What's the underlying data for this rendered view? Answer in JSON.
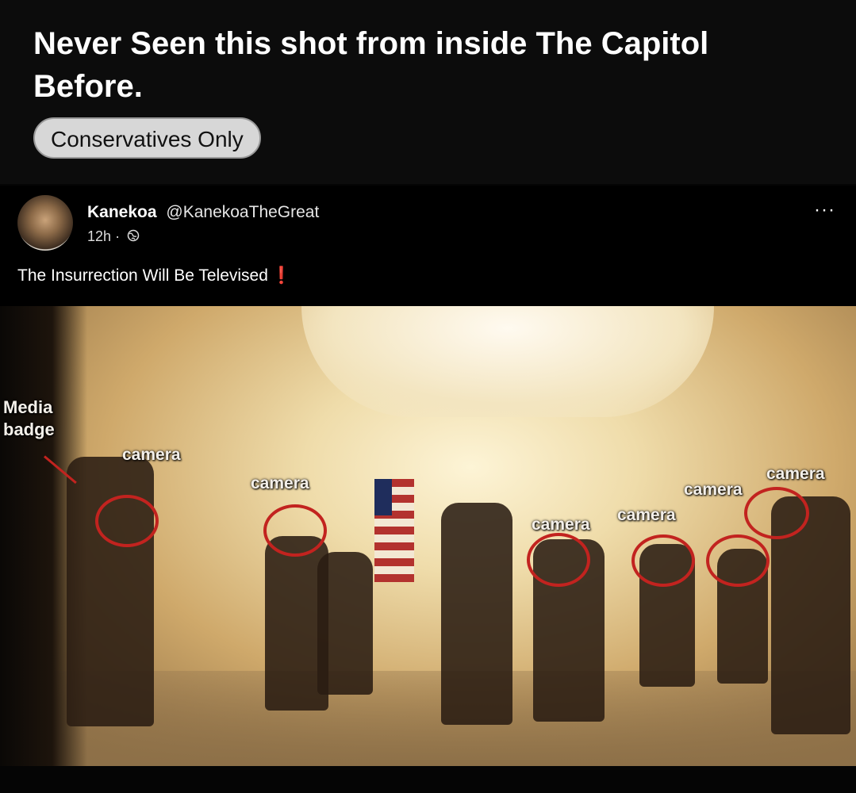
{
  "header": {
    "headline": "Never Seen this shot from inside The Capitol Before.",
    "group_label": "Conservatives Only"
  },
  "post": {
    "author_name": "Kanekoa",
    "author_handle": "@KanekoaTheGreat",
    "time": "12h",
    "separator": "·",
    "more_glyph": "···",
    "text": "The Insurrection Will Be Televised",
    "text_mark": "❗"
  },
  "photo": {
    "media_badge_line1": "Media",
    "media_badge_line2": "badge",
    "camera_labels": [
      "camera",
      "camera",
      "camera",
      "camera",
      "camera",
      "camera"
    ]
  },
  "colors": {
    "circle": "#c2231f",
    "pill_bg": "#d7d7d7"
  },
  "icons": [
    "avatar",
    "globe-icon",
    "more-options-icon"
  ]
}
